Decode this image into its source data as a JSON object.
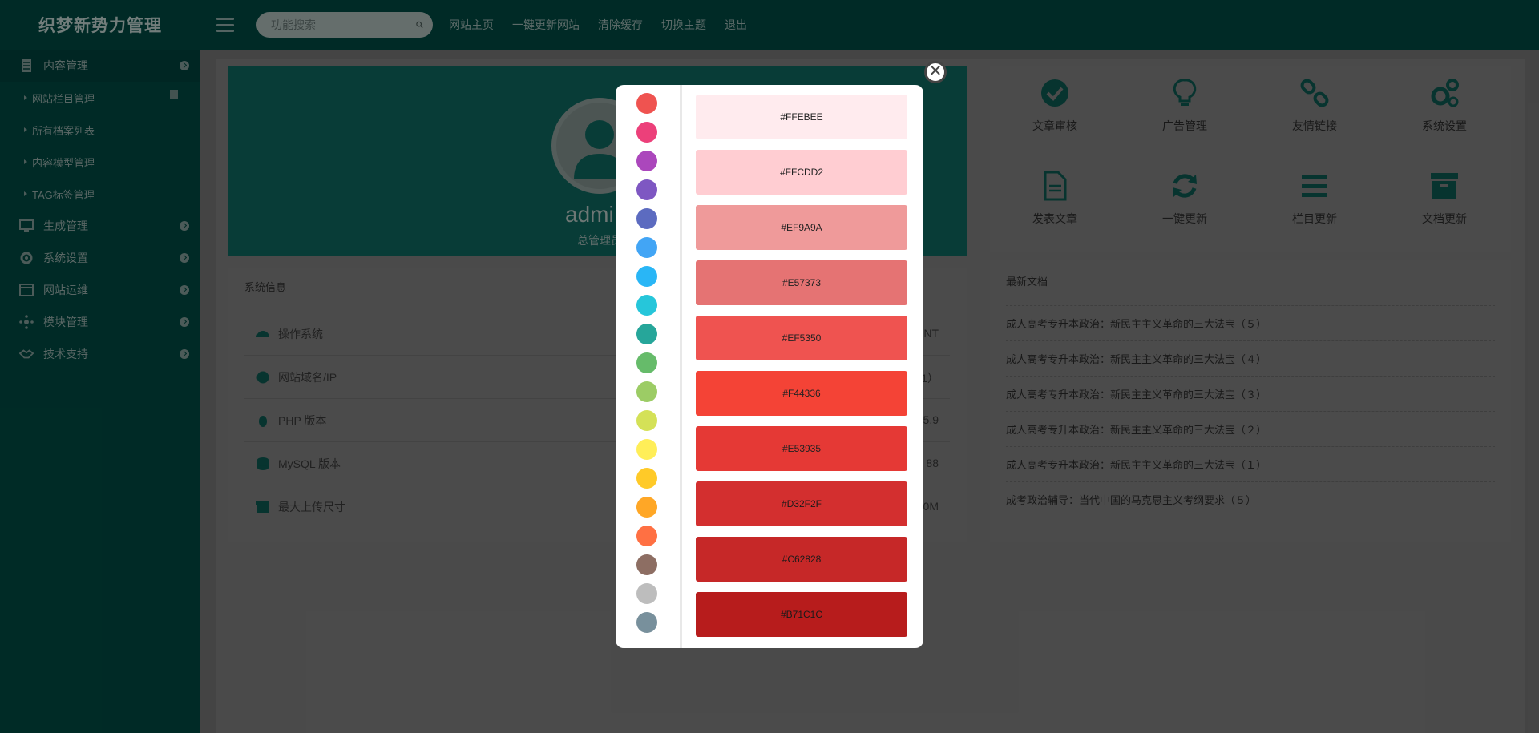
{
  "header": {
    "logo": "织梦新势力管理",
    "search_placeholder": "功能搜索",
    "nav": [
      "网站主页",
      "一键更新网站",
      "清除缓存",
      "切换主题",
      "退出"
    ]
  },
  "sidebar": {
    "groups": [
      {
        "label": "内容管理",
        "icon": "document-icon",
        "active": true
      },
      {
        "label": "生成管理",
        "icon": "monitor-icon"
      },
      {
        "label": "系统设置",
        "icon": "gear-icon"
      },
      {
        "label": "网站运维",
        "icon": "window-icon"
      },
      {
        "label": "模块管理",
        "icon": "cluster-icon"
      },
      {
        "label": "技术支持",
        "icon": "handshake-icon"
      }
    ],
    "sub_items": [
      "网站栏目管理",
      "所有档案列表",
      "内容模型管理",
      "TAG标签管理"
    ]
  },
  "hero": {
    "name": "admi",
    "role": "总管理员"
  },
  "sysinfo": {
    "title": "系统信息",
    "rows": [
      {
        "label": "操作系统",
        "value": "NT",
        "icon": "dashboard-icon"
      },
      {
        "label": "网站域名/IP",
        "value": "1）",
        "icon": "globe-icon"
      },
      {
        "label": "PHP 版本",
        "value": "5.9",
        "icon": "linux-icon"
      },
      {
        "label": "MySQL 版本",
        "value": "88",
        "icon": "database-icon"
      },
      {
        "label": "最大上传尺寸",
        "value": "0M",
        "icon": "archive-icon"
      }
    ]
  },
  "quick": {
    "items": [
      {
        "label": "文章审核",
        "icon": "check-circle-icon"
      },
      {
        "label": "广告管理",
        "icon": "lightbulb-icon"
      },
      {
        "label": "友情链接",
        "icon": "link-icon"
      },
      {
        "label": "系统设置",
        "icon": "gears-icon"
      },
      {
        "label": "发表文章",
        "icon": "file-text-icon"
      },
      {
        "label": "一键更新",
        "icon": "refresh-icon"
      },
      {
        "label": "栏目更新",
        "icon": "list-icon"
      },
      {
        "label": "文档更新",
        "icon": "archive-box-icon"
      }
    ]
  },
  "latest": {
    "title": "最新文档",
    "items": [
      "成人高考专升本政治：新民主主义革命的三大法宝（５）",
      "成人高考专升本政治：新民主主义革命的三大法宝（４）",
      "成人高考专升本政治：新民主主义革命的三大法宝（３）",
      "成人高考专升本政治：新民主主义革命的三大法宝（２）",
      "成人高考专升本政治：新民主主义革命的三大法宝（１）",
      "成考政治辅导：当代中国的马克思主义考纲要求（５）"
    ]
  },
  "modal": {
    "palette": [
      "#ef5350",
      "#ec407a",
      "#ab47bc",
      "#7e57c2",
      "#5c6bc0",
      "#42a5f5",
      "#29b6f6",
      "#26c6da",
      "#26a69a",
      "#66bb6a",
      "#9ccc65",
      "#d4e157",
      "#ffee58",
      "#ffca28",
      "#ffa726",
      "#ff7043",
      "#8d6e63",
      "#bdbdbd",
      "#78909c"
    ],
    "shades": [
      "#FFEBEE",
      "#FFCDD2",
      "#EF9A9A",
      "#E57373",
      "#EF5350",
      "#F44336",
      "#E53935",
      "#D32F2F",
      "#C62828",
      "#B71C1C"
    ]
  }
}
